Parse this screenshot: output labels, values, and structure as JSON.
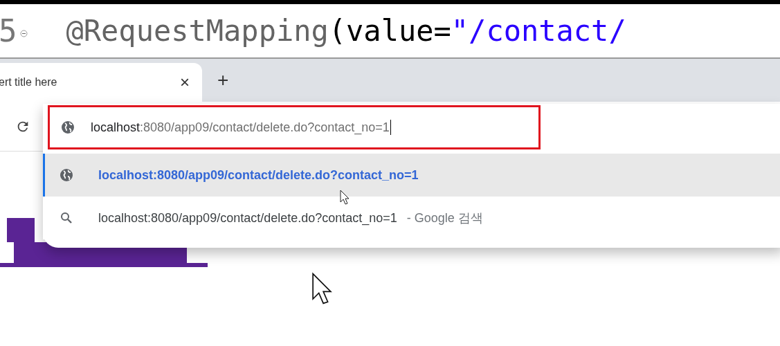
{
  "editor": {
    "line_number": "5",
    "tokens": [
      {
        "kind": "annotation",
        "text": "@RequestMapping"
      },
      {
        "kind": "plain",
        "text": "(value="
      },
      {
        "kind": "string",
        "text": "\"/contact/"
      }
    ]
  },
  "tab": {
    "title": "ert title here",
    "close": "×",
    "new_tab": "+"
  },
  "omnibox": {
    "host": "localhost",
    "rest": ":8080/app09/contact/delete.do?contact_no=1"
  },
  "suggestions": [
    {
      "kind": "url",
      "text": "localhost:8080/app09/contact/delete.do?contact_no=1",
      "selected": true
    },
    {
      "kind": "search",
      "text": "localhost:8080/app09/contact/delete.do?contact_no=1",
      "suffix": "- Google 검색",
      "selected": false
    }
  ]
}
